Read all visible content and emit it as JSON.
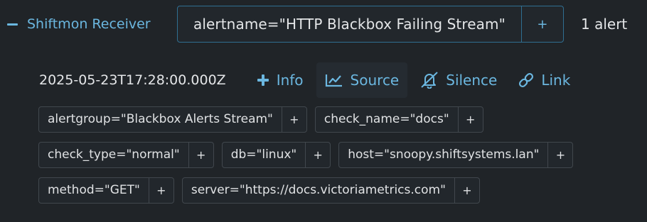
{
  "receiver": {
    "name": "Shiftmon Receiver",
    "group_label": "alertname=\"HTTP Blackbox Failing Stream\"",
    "add_symbol": "+",
    "count_text": "1 alert"
  },
  "alert": {
    "timestamp": "2025-05-23T17:28:00.000Z",
    "actions": {
      "info": "Info",
      "source": "Source",
      "silence": "Silence",
      "link": "Link"
    },
    "label_rows": [
      [
        "alertgroup=\"Blackbox Alerts Stream\"",
        "check_name=\"docs\""
      ],
      [
        "check_type=\"normal\"",
        "db=\"linux\"",
        "host=\"snoopy.shiftsystems.lan\""
      ],
      [
        "method=\"GET\"",
        "server=\"https://docs.victoriametrics.com\""
      ]
    ]
  },
  "colors": {
    "accent": "#6bb7e0",
    "background": "#202428",
    "text": "#e4e6e8",
    "border": "#41474d",
    "focus_border": "#2f6f92"
  },
  "icons": [
    "minus-icon",
    "plus-icon",
    "chart-line-icon",
    "bell-slash-icon",
    "link-icon"
  ]
}
